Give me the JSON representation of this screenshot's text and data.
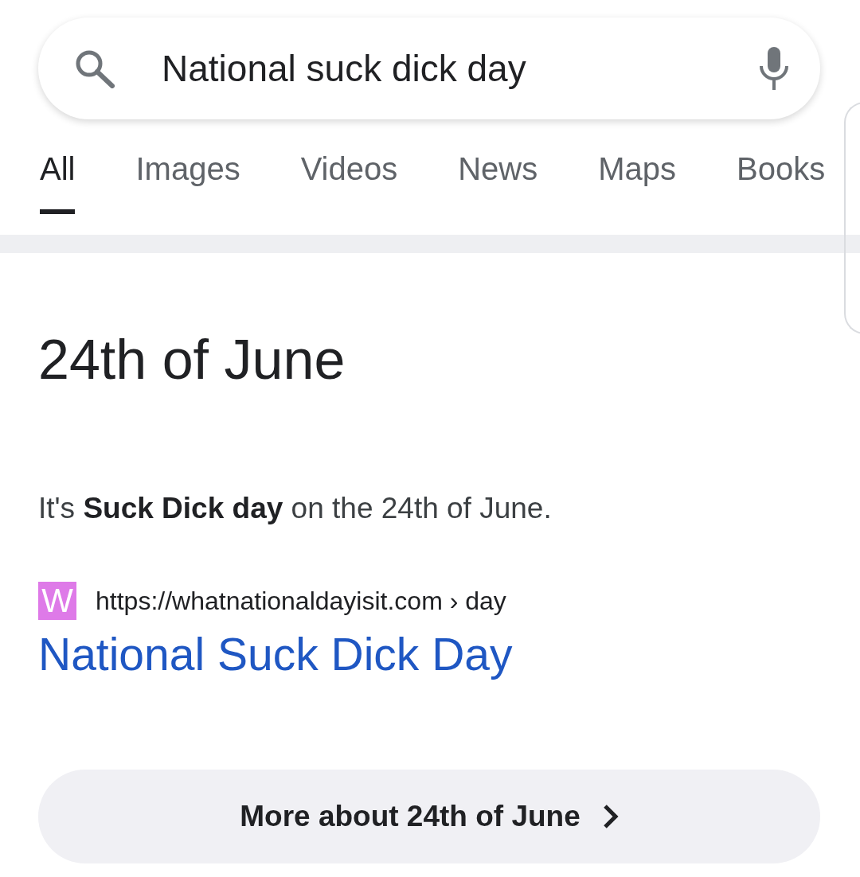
{
  "search": {
    "value": "National suck dick day"
  },
  "tabs": [
    {
      "label": "All",
      "selected": true
    },
    {
      "label": "Images",
      "selected": false
    },
    {
      "label": "Videos",
      "selected": false
    },
    {
      "label": "News",
      "selected": false
    },
    {
      "label": "Maps",
      "selected": false
    },
    {
      "label": "Books",
      "selected": false
    }
  ],
  "answer": {
    "title": "24th of June",
    "snippet": "It's **Suck Dick day** on the 24th of June."
  },
  "result": {
    "favicon_letter": "W",
    "url": "https://whatnationaldayisit.com › day",
    "title": "National Suck Dick Day"
  },
  "more_button": {
    "label": "More about 24th of June"
  }
}
